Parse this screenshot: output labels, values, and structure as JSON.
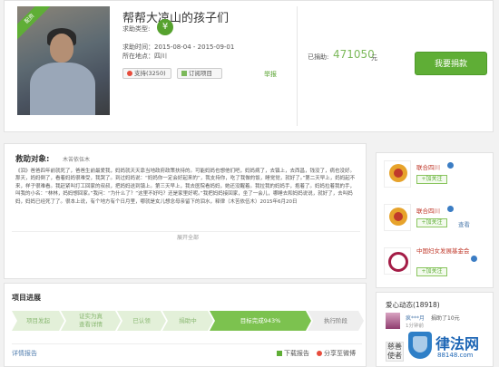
{
  "project": {
    "badge": "配资",
    "title": "帮帮大凉山的孩子们",
    "type_label": "求助类型:",
    "type_icon": "¥",
    "time": "求助时间：2015-08-04 - 2015-09-01",
    "location": "所在地点：四川",
    "support_label": "支持(3250)",
    "subscribe_label": "订阅项目",
    "report_label": "举报"
  },
  "fund": {
    "raised_label": "已捐助:",
    "raised_amount": "471050",
    "raised_unit": "元",
    "donate_label": "我要捐款"
  },
  "help": {
    "title": "救助对象:",
    "subtitle": "木苦依伍木",
    "text": "《泪》爸爸四年前就死了，爸爸生前最爱我，妈妈就天天靠当地政府政策扶持的。可能妈妈也想他们吧，妈妈病了，去镇上，去西昌，钱没了，病也没好。那天，妈妈倒了，看着妈妈很难受，我哭了。到过妈妈说：“妈妈你一定会好起来的”，我支持你，吃了我做的饭，睡觉觉，就好了。”第二天早上，妈妈起不来，样子很难看。我赶紧叫打工回家的叔叔，把妈妈送到镇上。第三天早上，我去医院看妈妈，她还没醒着。我拉我的妈妈手，抱着了。妈妈拉着我的手，叫我的小名：“林林，妈妈想回家。”我问：“为什么了？”这里不好吗？还是家里好呢。”我把妈妈接回家，坐了一会儿，哪睡去和妈妈说说，就好了，去叫妈妈，妈妈已经死了了。很本上说，有个地方有个日月里，哪就是女儿想念母亲留下的泪水，释律（木苦依伍木）2015年6月20日",
    "expand": "展开全部"
  },
  "progress": {
    "title": "项目进展",
    "steps": [
      "项目发起",
      "证实为真\n查看详情",
      "已认领",
      "捐助中",
      "目标完成943%",
      "执行阶段"
    ],
    "detail_link": "详情报告",
    "download_label": "下载报告",
    "share_label": "分享至微博"
  },
  "sidebar": {
    "orgs": [
      {
        "name": "联合四川",
        "follow": "+加关注"
      },
      {
        "name": "联合四川",
        "follow": "+加关注",
        "look": "查看"
      },
      {
        "name": "中国妇女发展基金会",
        "follow": "+加关注"
      }
    ]
  },
  "love": {
    "title": "爱心动态(18918)",
    "user": "疯***月",
    "action": "捐助了10元",
    "time": "1分钟前",
    "avatar2_text": "慈善\n使者"
  },
  "watermark": {
    "name": "律法网",
    "url": "88148.com"
  }
}
